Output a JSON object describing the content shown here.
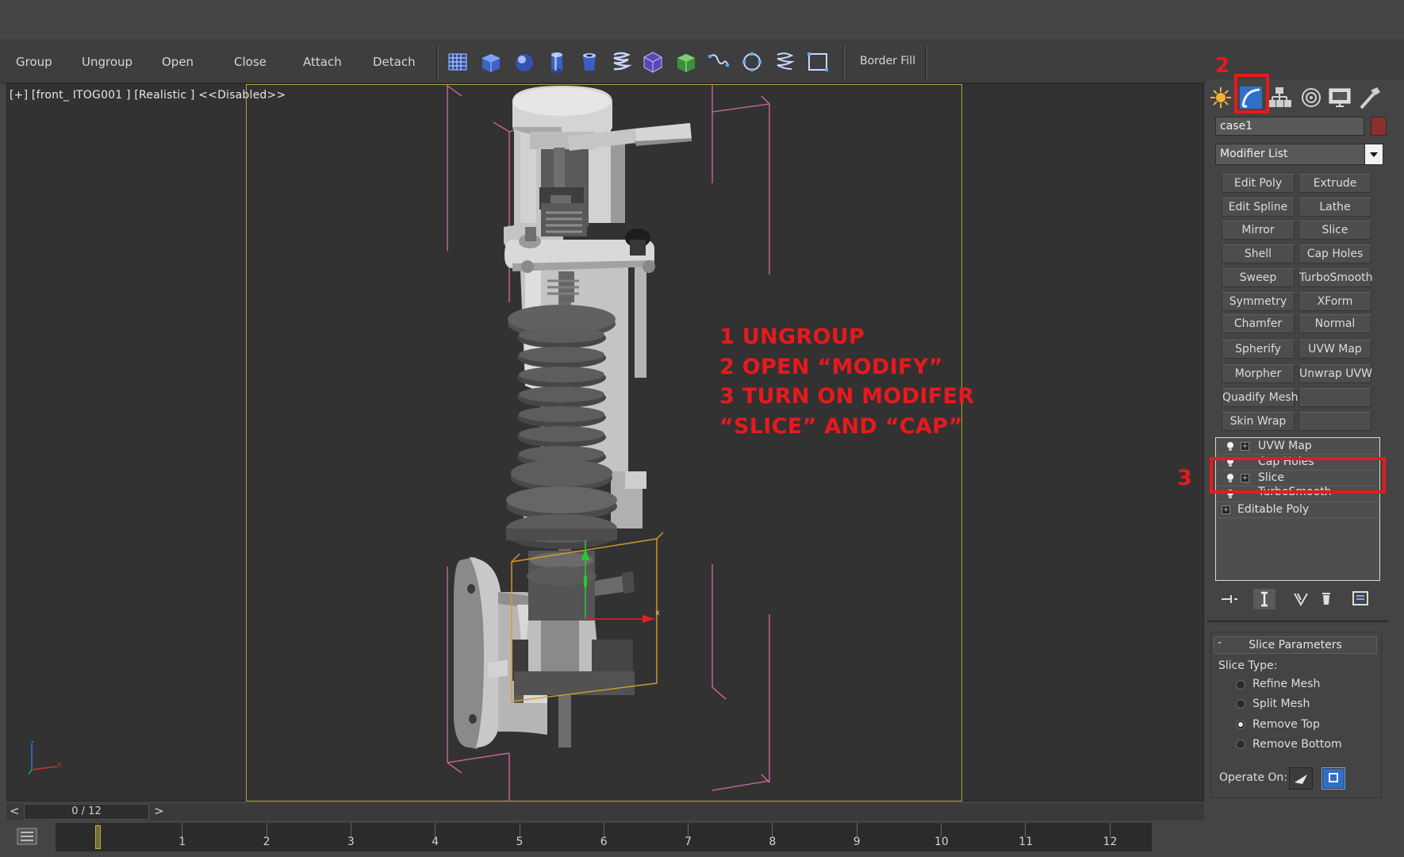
{
  "toolbar": {
    "group_menu": [
      "Group",
      "Ungroup",
      "Open",
      "Close",
      "Attach",
      "Detach"
    ],
    "border_fill": "Border Fill"
  },
  "viewport": {
    "label": "[+] [front_ ITOG001 ] [Realistic ]  <<Disabled>>"
  },
  "annotations": {
    "instructions": [
      "1 UNGROUP",
      "2 OPEN “MODIFY”",
      "3 TURN ON MODIFER",
      "“SLICE” AND “CAP”"
    ],
    "marker_2": "2",
    "marker_3": "3",
    "highlight_color": "#e8191d"
  },
  "command_panel": {
    "tabs": [
      "create-icon",
      "modify-icon",
      "hierarchy-icon",
      "motion-icon",
      "display-icon",
      "utilities-icon"
    ],
    "object_name": "case1",
    "object_color": "#8d2f2f",
    "modifier_list_label": "Modifier List",
    "modifier_buttons": [
      [
        "Edit Poly",
        "Extrude"
      ],
      [
        "Edit Spline",
        "Lathe"
      ],
      [
        "Mirror",
        "Slice"
      ],
      [
        "Shell",
        "Cap Holes"
      ],
      [
        "Sweep",
        "TurboSmooth"
      ],
      [
        "Symmetry",
        "XForm"
      ],
      [
        "Chamfer",
        "Normal"
      ],
      [
        "Spherify",
        "UVW Map"
      ],
      [
        "Morpher",
        "Unwrap UVW"
      ],
      [
        "Quadify Mesh",
        ""
      ],
      [
        "Skin Wrap",
        ""
      ]
    ],
    "stack": [
      "UVW Map",
      "Cap Holes",
      "Slice",
      "TurboSmooth",
      "Editable Poly"
    ],
    "slice_parameters": {
      "title": "Slice Parameters",
      "collapse": "-",
      "slice_type_label": "Slice Type:",
      "options": [
        "Refine Mesh",
        "Split Mesh",
        "Remove Top",
        "Remove Bottom"
      ],
      "selected": "Remove Top",
      "operate_on_label": "Operate On:"
    }
  },
  "timeline": {
    "slider_text": "0 / 12",
    "prev": "<",
    "next": ">",
    "frames": [
      "0",
      "1",
      "2",
      "3",
      "4",
      "5",
      "6",
      "7",
      "8",
      "9",
      "10",
      "11",
      "12"
    ]
  }
}
